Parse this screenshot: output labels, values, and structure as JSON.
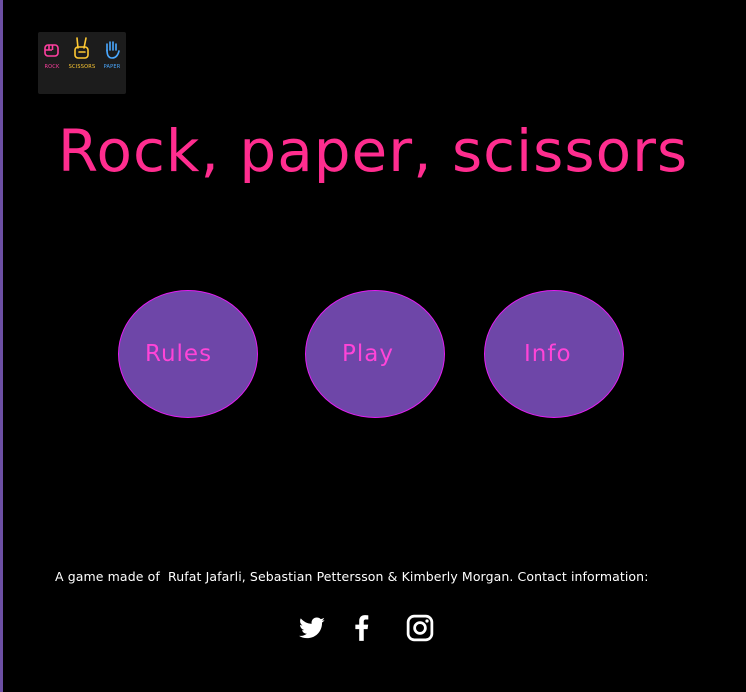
{
  "logo": {
    "items": [
      {
        "label": "ROCK",
        "color": "#ff3fa0",
        "icon": "fist-icon"
      },
      {
        "label": "SCISSORS",
        "color": "#ffc933",
        "icon": "peace-hand-icon"
      },
      {
        "label": "PAPER",
        "color": "#4aa8ff",
        "icon": "open-hand-icon"
      }
    ]
  },
  "title": "Rock, paper, scissors",
  "nav": {
    "rules": "Rules",
    "play": "Play",
    "info": "Info"
  },
  "footer": {
    "text": "A game made of  Rufat Jafarli, Sebastian Pettersson & Kimberly Morgan. Contact information:",
    "social": [
      "twitter-icon",
      "facebook-icon",
      "instagram-icon"
    ]
  },
  "colors": {
    "background": "#000000",
    "title": "#ff2d8f",
    "button_fill": "#6e46a8",
    "button_border": "#e21df2",
    "button_text": "#ff44d8",
    "footer_text": "#ffffff"
  }
}
